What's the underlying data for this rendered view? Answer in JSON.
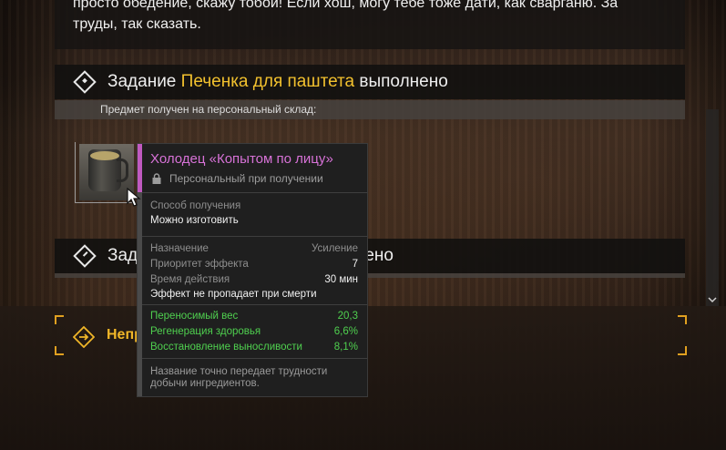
{
  "intro_text": "просто обедение, скажу тобой! Если хош, могу тебе тоже дати, как сварганю. За труды, так сказать.",
  "quest1": {
    "prefix": "Задание",
    "name": "Печенка для паштета",
    "suffix": "выполнено"
  },
  "received_text": "Предмет получен на персональный склад:",
  "quest2": {
    "prefix": "Зада",
    "suffix": "олучено"
  },
  "unfinished_label": "Непр",
  "tooltip": {
    "name": "Холодец «Копытом по лицу»",
    "binding": "Персональный при получении",
    "obtain_label": "Способ получения",
    "obtain_value": "Можно изготовить",
    "purpose_label": "Назначение",
    "purpose_value": "Усиление",
    "priority_label": "Приоритет эффекта",
    "priority_value": "7",
    "duration_label": "Время действия",
    "duration_value": "30 мин",
    "persist_note": "Эффект не пропадает при смерти",
    "stats": [
      {
        "label": "Переносимый вес",
        "value": "20,3"
      },
      {
        "label": "Регенерация здоровья",
        "value": "6,6%"
      },
      {
        "label": "Восстановление выносливости",
        "value": "8,1%"
      }
    ],
    "description": "Название точно передает трудности добычи ингредиентов."
  },
  "colors": {
    "highlight": "#f2c12e",
    "item_name": "#d772d7",
    "stat_green": "#4fd04f",
    "accent_orange": "#e0a020"
  }
}
